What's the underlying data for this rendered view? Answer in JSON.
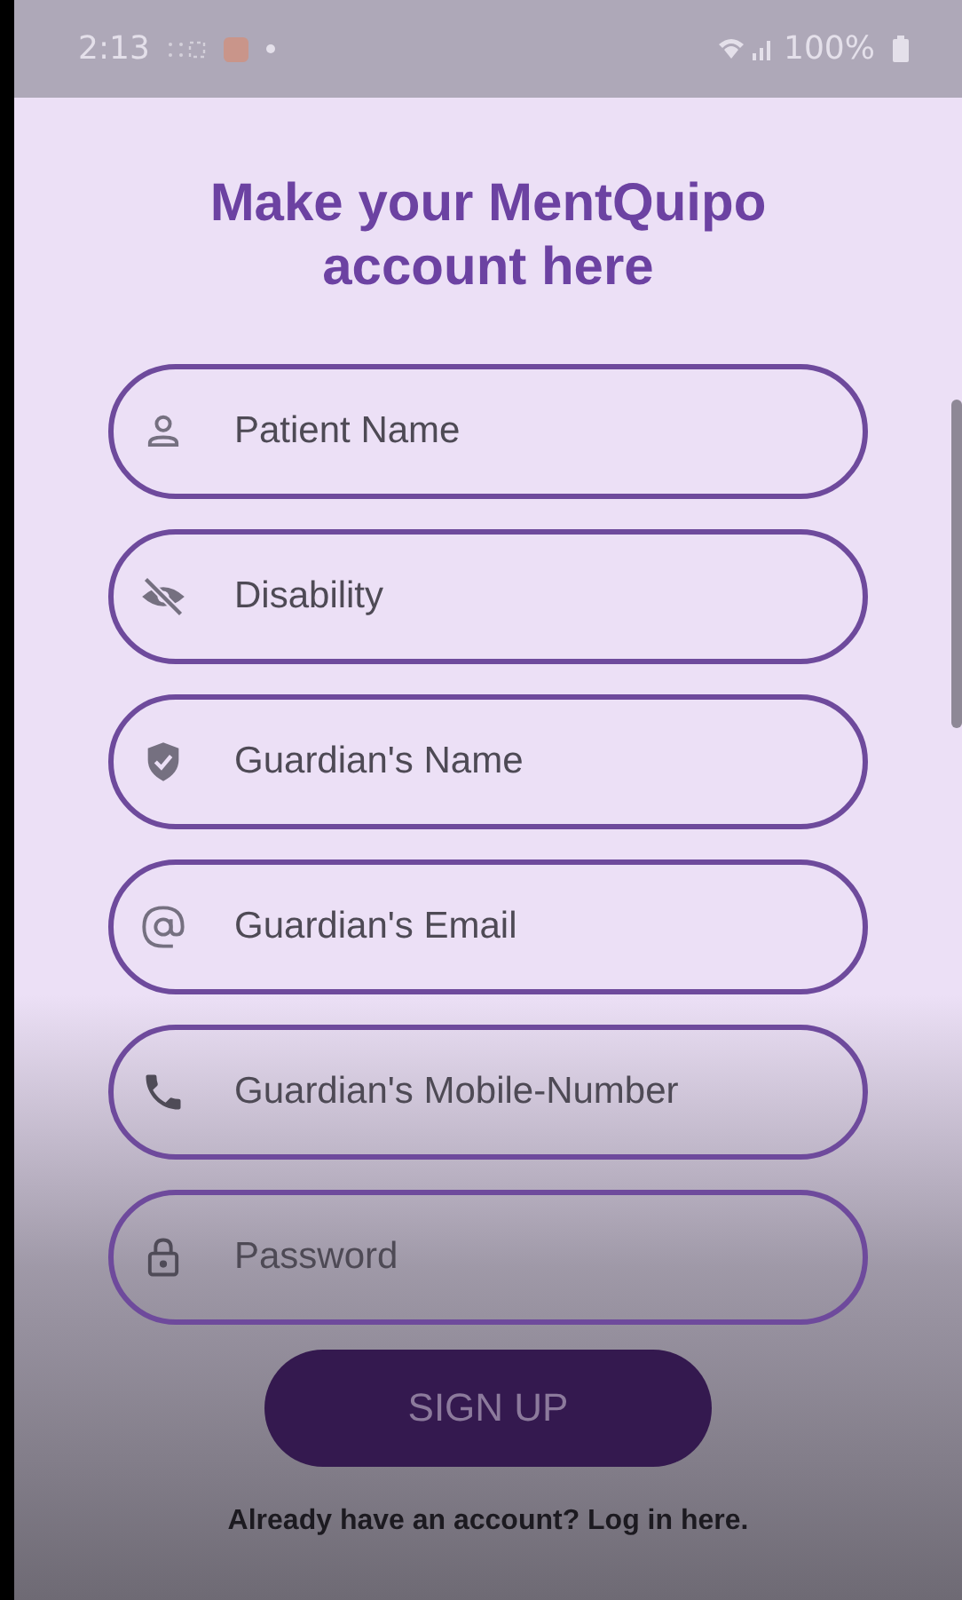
{
  "status_bar": {
    "time": "2:13",
    "battery": "100%"
  },
  "title": "Make your MentQuipo account here",
  "fields": [
    {
      "kind": "name",
      "placeholder": "Patient Name"
    },
    {
      "kind": "disability",
      "placeholder": "Disability"
    },
    {
      "kind": "guardian",
      "placeholder": "Guardian's Name"
    },
    {
      "kind": "email",
      "placeholder": "Guardian's Email"
    },
    {
      "kind": "phone",
      "placeholder": "Guardian's Mobile-Number"
    },
    {
      "kind": "password",
      "placeholder": "Password"
    }
  ],
  "submit_button": "SIGN UP",
  "login_link": "Already have an account? Log in here."
}
